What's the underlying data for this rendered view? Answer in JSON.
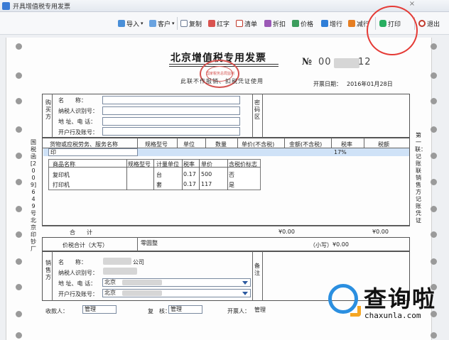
{
  "window": {
    "title": "开具增值税专用发票",
    "close_glyph": "×"
  },
  "toolbar": {
    "import_label": "导入",
    "customer_label": "客户",
    "copy_label": "复制",
    "red_label": "红字",
    "list_label": "清单",
    "discount_label": "折扣",
    "price_label": "价格",
    "add_row_label": "增行",
    "del_row_label": "减行",
    "print_label": "打印",
    "exit_label": "退出",
    "dropdown_glyph": "▾"
  },
  "invoice": {
    "title": "北京增值税专用发票",
    "subtitle": "此联不作报销、扣税凭证使用",
    "no_mark": "№",
    "no_value": "00",
    "no_value_tail": "12",
    "seal_text": "国家税务总局监制",
    "date_label": "开票日期：",
    "date_value": "2016年01月28日",
    "left_vertical": "国税函[2009]649号北京印钞厂",
    "right_vertical": "第一联：记账联 销售方记账凭证",
    "buyer": {
      "side_label": "购买方",
      "name_label": "名　　称：",
      "taxid_label": "纳税人识别号：",
      "addr_label": "地 址、电 话：",
      "bank_label": "开户行及账号："
    },
    "cipher_label": "密码区",
    "columns": {
      "goods": "货物或应税劳务、服务名称",
      "spec": "规格型号",
      "unit": "单位",
      "qty": "数量",
      "price": "单价(不含税)",
      "amount": "金额(不含税)",
      "rate": "税率",
      "tax": "税额"
    },
    "selected_row": {
      "goods": "印",
      "rate": "17%"
    },
    "popup": {
      "headers": [
        "商品名称",
        "规格型号",
        "计量单位",
        "税率",
        "单价",
        "含税价标志"
      ],
      "rows": [
        [
          "复印机",
          "",
          "台",
          "0.17",
          "500",
          "否"
        ],
        [
          "打印机",
          "",
          "套",
          "0.17",
          "117",
          "是"
        ]
      ]
    },
    "total_label": "合　　计",
    "total_amount": "¥0.00",
    "total_tax": "¥0.00",
    "total_words_label": "价税合计（大写）",
    "total_words_value": "零圆整",
    "total_small_label": "（小写）",
    "total_small_value": "¥0.00",
    "seller": {
      "side_label": "销售方",
      "name_label": "名　　称：",
      "name_value_tail": "公司",
      "taxid_label": "纳税人识别号：",
      "addr_label": "地 址、电 话：",
      "addr_value": "北京",
      "bank_label": "开户行及账号：",
      "bank_value": "北京"
    },
    "remark_label": "备注",
    "payee_label": "收款人：",
    "payee_value": "管理",
    "reviewer_label": "复　核：",
    "reviewer_value": "管理",
    "drawer_label": "开票人：",
    "drawer_value": "管理"
  },
  "watermark": {
    "brand": "查询啦",
    "url": "chaxunla.com"
  },
  "colors": {
    "annotation": "#e53a35",
    "selection": "#cfe2f7",
    "seal": "#d4524f",
    "brand_blue": "#2b8fe0",
    "brand_orange": "#f5a623"
  },
  "icons": {
    "import": "import-icon",
    "customer": "customer-icon",
    "copy": "copy-icon",
    "red": "red-invoice-icon",
    "list": "list-icon",
    "discount": "discount-icon",
    "price": "price-icon",
    "add_row": "add-row-icon",
    "del_row": "delete-row-icon",
    "print": "printer-icon",
    "exit": "power-icon"
  }
}
